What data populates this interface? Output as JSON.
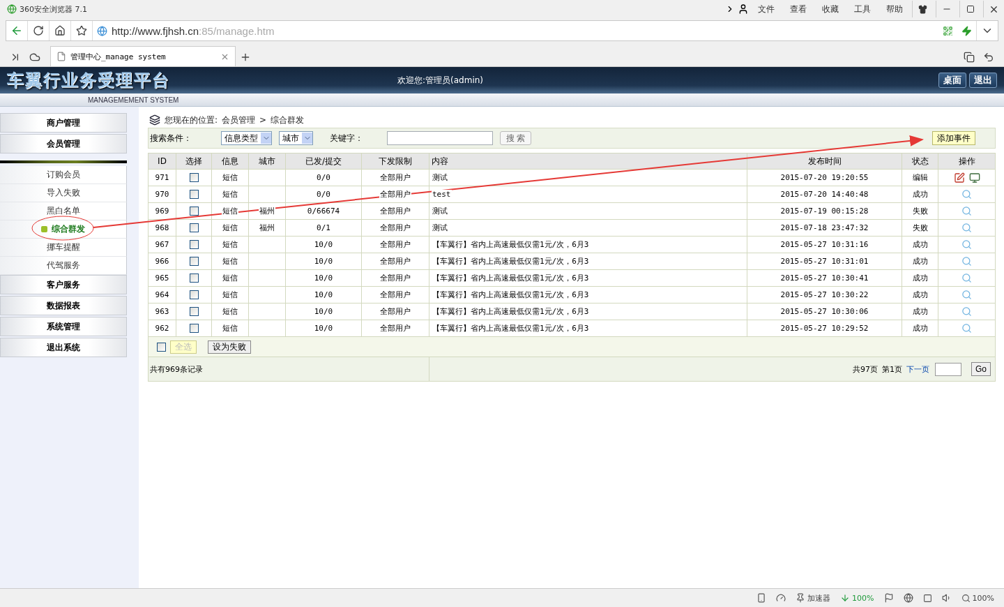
{
  "browser": {
    "title": "360安全浏览器 7.1",
    "menu": [
      "文件",
      "查看",
      "收藏",
      "工具",
      "帮助"
    ],
    "url_host": "http://www.fjhsh.cn",
    "url_rest": ":85/manage.htm",
    "tab_title": "管理中心_manage system"
  },
  "header": {
    "logo": "车翼行业务受理平台",
    "subtitle": "MANAGEMEMENT SYSTEM",
    "welcome": "欢迎您:管理员(admin)",
    "buttons": [
      "桌面",
      "退出"
    ]
  },
  "sidebar": {
    "top": [
      "商户管理",
      "会员管理"
    ],
    "links": [
      {
        "label": "订购会员",
        "selected": false
      },
      {
        "label": "导入失败",
        "selected": false
      },
      {
        "label": "黑白名单",
        "selected": false
      },
      {
        "label": "综合群发",
        "selected": true
      },
      {
        "label": "挪车提醒",
        "selected": false
      },
      {
        "label": "代驾服务",
        "selected": false
      }
    ],
    "bottom": [
      "客户服务",
      "数据报表",
      "系统管理",
      "退出系统"
    ]
  },
  "breadcrumb": {
    "label": "您现在的位置:",
    "path": [
      "会员管理",
      "综合群发"
    ],
    "separator": ">"
  },
  "search": {
    "label": "搜索条件：",
    "selects": [
      "信息类型",
      "城市"
    ],
    "keyword_label": "关键字：",
    "button": "搜 索",
    "add_button": "添加事件"
  },
  "table": {
    "columns": [
      "ID",
      "选择",
      "信息",
      "城市",
      "已发/提交",
      "下发限制",
      "内容",
      "发布时间",
      "状态",
      "操作"
    ],
    "rows": [
      {
        "id": "971",
        "checked": false,
        "info": "短信",
        "city": "",
        "sent": "0/0",
        "limit": "全部用户",
        "content": "测试",
        "time": "2015-07-20 19:20:55",
        "status": "编辑",
        "kind": "edit"
      },
      {
        "id": "970",
        "checked": false,
        "info": "短信",
        "city": "",
        "sent": "0/0",
        "limit": "全部用户",
        "content": "test",
        "time": "2015-07-20 14:40:48",
        "status": "成功",
        "kind": "view"
      },
      {
        "id": "969",
        "checked": false,
        "info": "短信",
        "city": "福州",
        "sent": "0/66674",
        "limit": "全部用户",
        "content": "测试",
        "time": "2015-07-19 00:15:28",
        "status": "失败",
        "kind": "view"
      },
      {
        "id": "968",
        "checked": false,
        "info": "短信",
        "city": "福州",
        "sent": "0/1",
        "limit": "全部用户",
        "content": "测试",
        "time": "2015-07-18 23:47:32",
        "status": "失败",
        "kind": "view"
      },
      {
        "id": "967",
        "checked": false,
        "info": "短信",
        "city": "",
        "sent": "10/0",
        "limit": "全部用户",
        "content": "【车翼行】省内上高速最低仅需1元/次，6月3",
        "time": "2015-05-27 10:31:16",
        "status": "成功",
        "kind": "view"
      },
      {
        "id": "966",
        "checked": false,
        "info": "短信",
        "city": "",
        "sent": "10/0",
        "limit": "全部用户",
        "content": "【车翼行】省内上高速最低仅需1元/次，6月3",
        "time": "2015-05-27 10:31:01",
        "status": "成功",
        "kind": "view"
      },
      {
        "id": "965",
        "checked": false,
        "info": "短信",
        "city": "",
        "sent": "10/0",
        "limit": "全部用户",
        "content": "【车翼行】省内上高速最低仅需1元/次，6月3",
        "time": "2015-05-27 10:30:41",
        "status": "成功",
        "kind": "view"
      },
      {
        "id": "964",
        "checked": false,
        "info": "短信",
        "city": "",
        "sent": "10/0",
        "limit": "全部用户",
        "content": "【车翼行】省内上高速最低仅需1元/次，6月3",
        "time": "2015-05-27 10:30:22",
        "status": "成功",
        "kind": "view"
      },
      {
        "id": "963",
        "checked": false,
        "info": "短信",
        "city": "",
        "sent": "10/0",
        "limit": "全部用户",
        "content": "【车翼行】省内上高速最低仅需1元/次，6月3",
        "time": "2015-05-27 10:30:06",
        "status": "成功",
        "kind": "view"
      },
      {
        "id": "962",
        "checked": false,
        "info": "短信",
        "city": "",
        "sent": "10/0",
        "limit": "全部用户",
        "content": "【车翼行】省内上高速最低仅需1元/次，6月3",
        "time": "2015-05-27 10:29:52",
        "status": "成功",
        "kind": "view"
      }
    ]
  },
  "bulk": {
    "checked": false,
    "select_all": "全选",
    "fail_button": "设为失败"
  },
  "pager": {
    "total": "共有969条记录",
    "pages": "共97页",
    "current": "第1页",
    "next": "下一页",
    "go": "Go"
  },
  "status_bar": {
    "accelerator": "加速器",
    "download": "100%",
    "zoom": "100%"
  }
}
